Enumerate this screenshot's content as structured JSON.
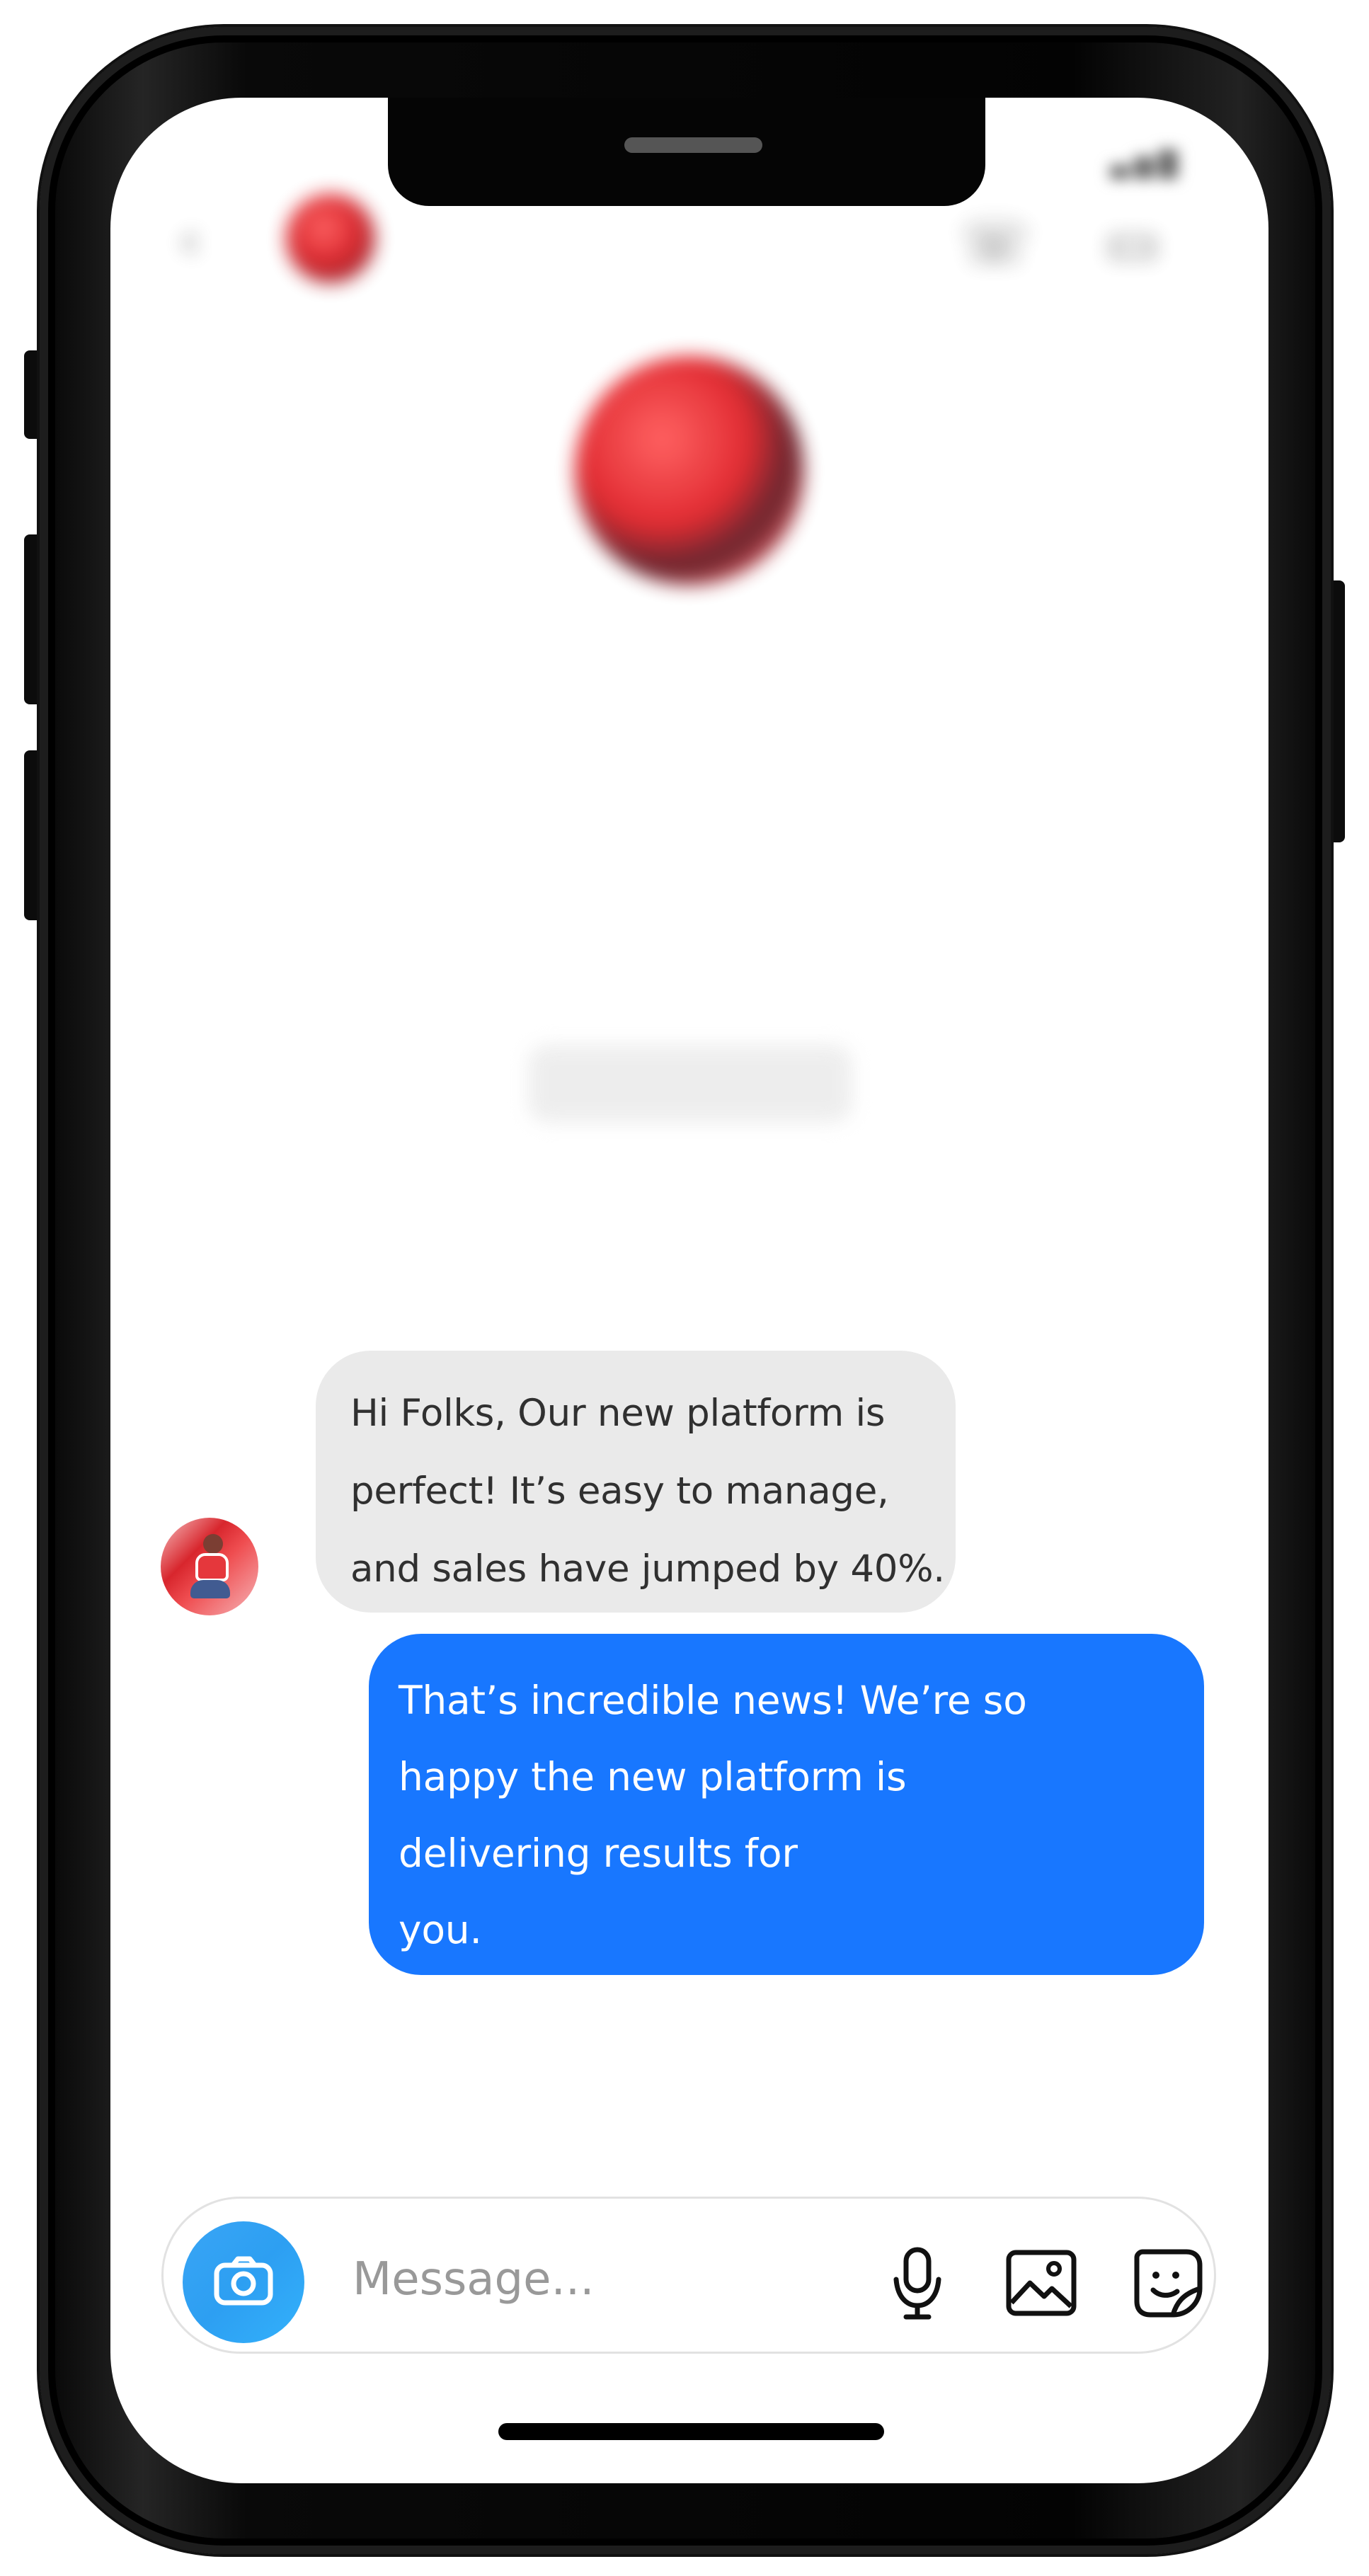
{
  "blurred_header": {
    "status_time": "",
    "contact_name": "",
    "contact_subtitle": "",
    "back_icon": "chevron-left-icon",
    "call_icon": "phone-icon",
    "video_icon": "video-icon"
  },
  "blurred_profile": {
    "name": "",
    "line_1": "",
    "line_2": "",
    "line_3": "",
    "line_4": "",
    "button_label": "",
    "timestamp": ""
  },
  "conversation": {
    "incoming_message": "Hi Folks, Our new platform is\nperfect! It’s easy to manage,\nand sales have jumped by 40%.",
    "outgoing_message": " That’s incredible news! We’re so\nhappy the new platform is\ndelivering results for\nyou."
  },
  "composer": {
    "placeholder": "Message...",
    "camera_icon": "camera-icon",
    "microphone_icon": "microphone-icon",
    "gallery_icon": "gallery-icon",
    "sticker_icon": "sticker-icon"
  },
  "colors": {
    "outgoing_bubble": "#1877ff",
    "incoming_bubble": "#eaeaea",
    "camera_button": "#2d9ff2",
    "phone_frame": "#050505"
  }
}
